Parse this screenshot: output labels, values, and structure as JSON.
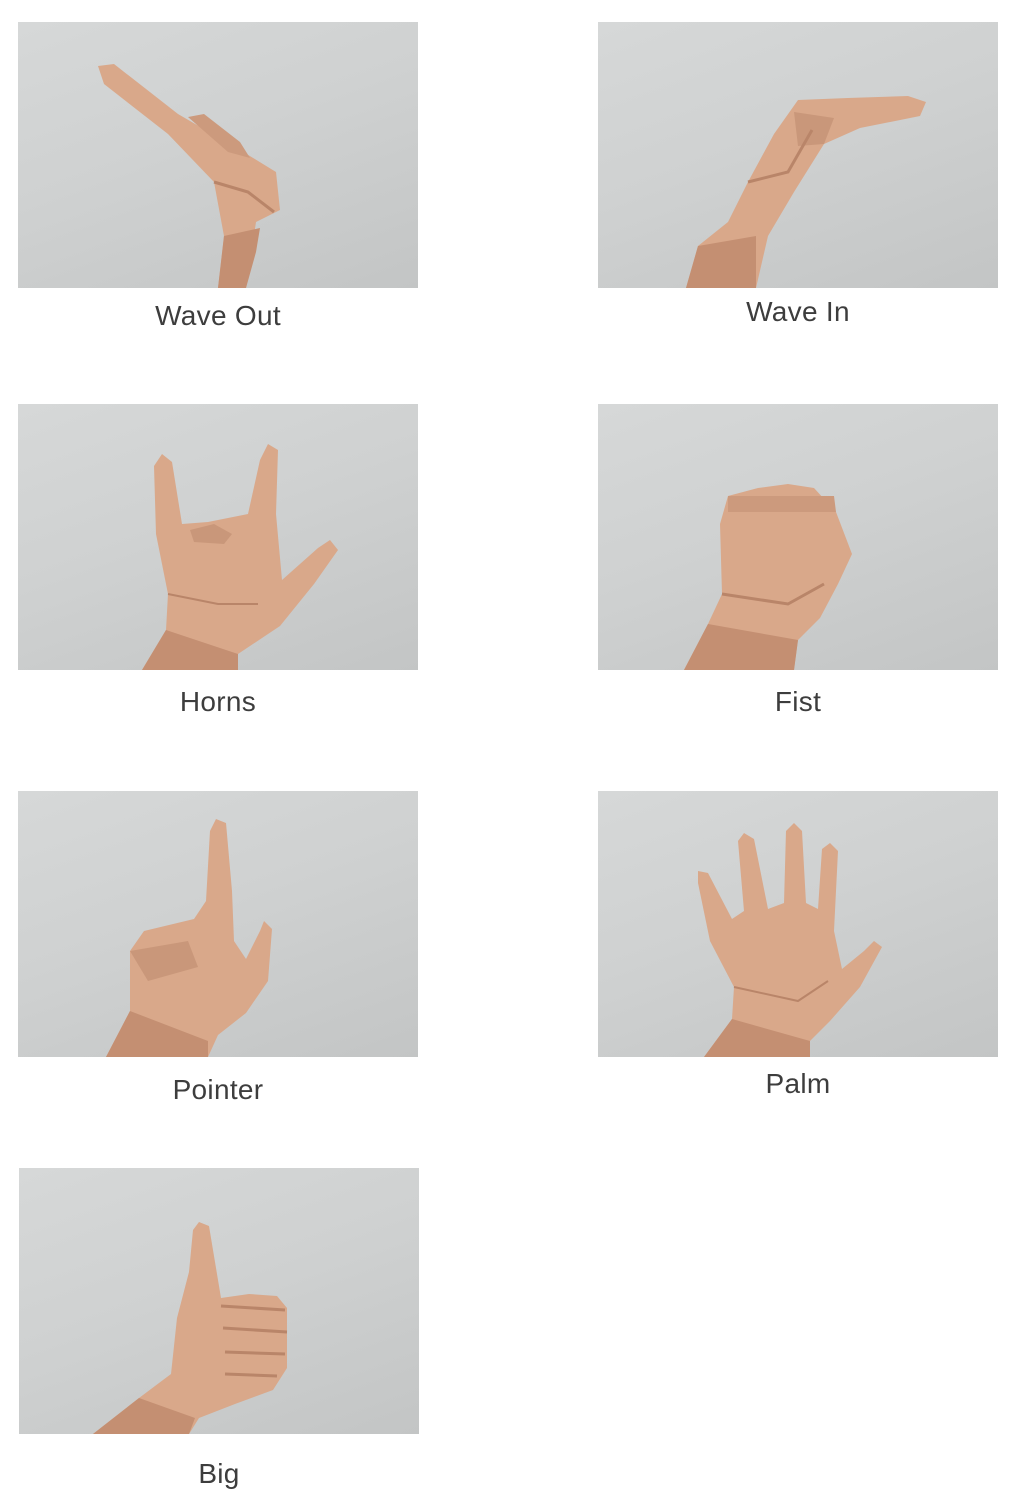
{
  "gestures": [
    {
      "label": "Wave Out",
      "icon": "wave-out-hand-icon"
    },
    {
      "label": "Wave In",
      "icon": "wave-in-hand-icon"
    },
    {
      "label": "Horns",
      "icon": "horns-hand-icon"
    },
    {
      "label": "Fist",
      "icon": "fist-hand-icon"
    },
    {
      "label": "Pointer",
      "icon": "pointer-hand-icon"
    },
    {
      "label": "Palm",
      "icon": "palm-hand-icon"
    },
    {
      "label": "Big",
      "icon": "thumbs-up-hand-icon"
    }
  ],
  "colors": {
    "skin": "#d9a88a",
    "skin_shadow": "#b98569",
    "wall": "#d2d4d4",
    "caption": "#3d3d3d"
  }
}
